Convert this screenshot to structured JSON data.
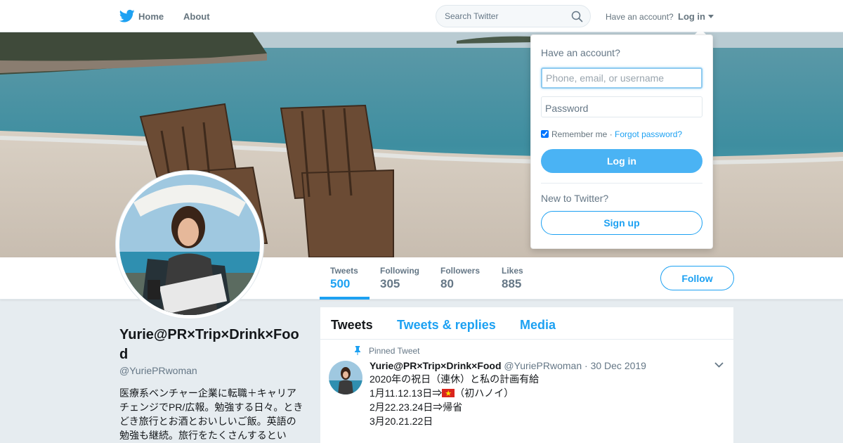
{
  "nav": {
    "home_label": "Home",
    "about_label": "About",
    "search_placeholder": "Search Twitter",
    "have_account": "Have an account?",
    "login_label": "Log in"
  },
  "profile": {
    "display_name": "Yurie@PR×Trip×Drink×Food",
    "handle": "@YuriePRwoman",
    "bio": "医療系ベンチャー企業に転職＋キャリアチェンジでPR/広報。勉強する日々。ときどき旅行とお酒とおいしいご飯。英語の勉強も継続。旅行をたくさんするとい",
    "follow_label": "Follow"
  },
  "stats": [
    {
      "label": "Tweets",
      "value": "500"
    },
    {
      "label": "Following",
      "value": "305"
    },
    {
      "label": "Followers",
      "value": "80"
    },
    {
      "label": "Likes",
      "value": "885"
    }
  ],
  "timeline": {
    "tabs": [
      "Tweets",
      "Tweets & replies",
      "Media"
    ],
    "pinned_label": "Pinned Tweet",
    "tweet": {
      "name": "Yurie@PR×Trip×Drink×Food",
      "handle": "@YuriePRwoman",
      "date": "30 Dec 2019",
      "lines": [
        "2020年の祝日（連休）と私の計画有給",
        "1月11.12.13日⇒",
        "（初ハノイ）",
        "2月22.23.24日⇒帰省",
        "3月20.21.22日"
      ]
    }
  },
  "login_dropdown": {
    "title": "Have an account?",
    "username_placeholder": "Phone, email, or username",
    "password_label": "Password",
    "remember_label": "Remember me",
    "separator": "·",
    "forgot_label": "Forgot password?",
    "login_button": "Log in",
    "new_label": "New to Twitter?",
    "signup_button": "Sign up"
  },
  "colors": {
    "accent": "#1da1f2",
    "button_fill": "#4ab3f4",
    "background": "#e6ecf0"
  }
}
